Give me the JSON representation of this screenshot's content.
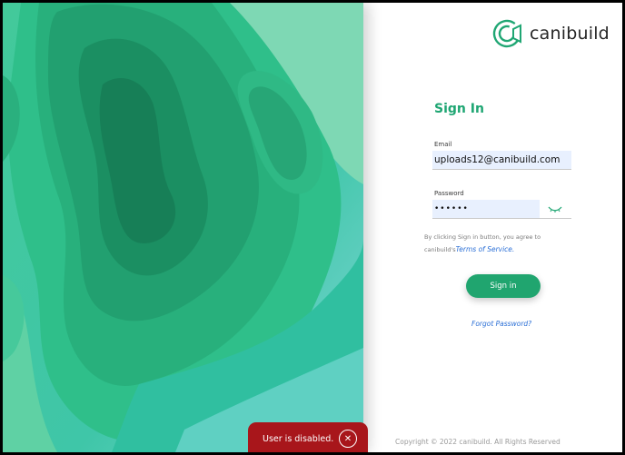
{
  "brand": {
    "name": "canibuild",
    "accent": "#1fa673"
  },
  "signin": {
    "title": "Sign In",
    "email_label": "Email",
    "email_value": "uploads12@canibuild.com",
    "password_label": "Password",
    "password_value": "••••••",
    "agree_text": "By clicking Sign in button, you agree to canibuild's",
    "terms_link": "Terms of Service.",
    "button_label": "Sign in",
    "forgot_link": "Forgot Password?"
  },
  "footer": {
    "copyright": "Copyright © 2022 canibuild. All Rights Reserved"
  },
  "toast": {
    "message": "User is disabled.",
    "close_icon": "close-icon",
    "color": "#a8161b"
  },
  "icons": {
    "logo": "canibuild-logo-icon",
    "eye": "eye-closed-icon"
  }
}
